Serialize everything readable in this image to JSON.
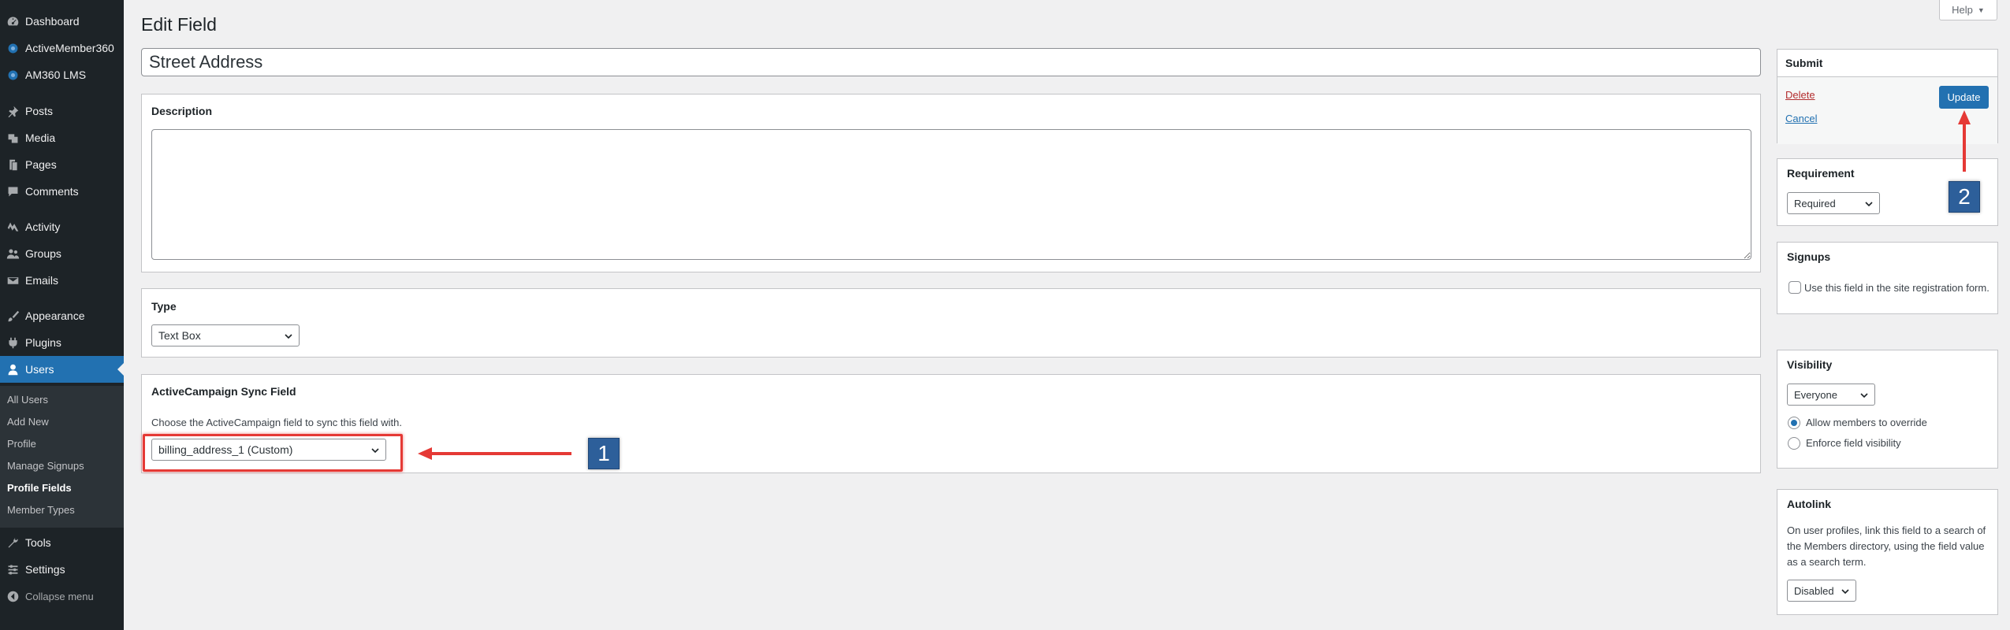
{
  "sidebar": {
    "items": [
      {
        "label": "Dashboard",
        "icon": "dashboard-icon"
      },
      {
        "label": "ActiveMember360",
        "icon": "activemember-icon"
      },
      {
        "label": "AM360 LMS",
        "icon": "lms-icon"
      },
      {
        "label": "Posts",
        "icon": "pin-icon"
      },
      {
        "label": "Media",
        "icon": "media-icon"
      },
      {
        "label": "Pages",
        "icon": "pages-icon"
      },
      {
        "label": "Comments",
        "icon": "comment-icon"
      },
      {
        "label": "Activity",
        "icon": "activity-icon"
      },
      {
        "label": "Groups",
        "icon": "groups-icon"
      },
      {
        "label": "Emails",
        "icon": "email-icon"
      },
      {
        "label": "Appearance",
        "icon": "brush-icon"
      },
      {
        "label": "Plugins",
        "icon": "plugin-icon"
      },
      {
        "label": "Users",
        "icon": "user-icon"
      },
      {
        "label": "Tools",
        "icon": "wrench-icon"
      },
      {
        "label": "Settings",
        "icon": "settings-icon"
      }
    ],
    "submenu": [
      "All Users",
      "Add New",
      "Profile",
      "Manage Signups",
      "Profile Fields",
      "Member Types"
    ],
    "current_item": "Users",
    "current_submenu": "Profile Fields",
    "collapse_label": "Collapse menu"
  },
  "help_tab": {
    "label": "Help"
  },
  "page": {
    "title": "Edit Field",
    "field_name": "Street Address"
  },
  "description": {
    "title": "Description",
    "value": ""
  },
  "type": {
    "title": "Type",
    "selected": "Text Box"
  },
  "activecampaign": {
    "title": "ActiveCampaign Sync Field",
    "help": "Choose the ActiveCampaign field to sync this field with.",
    "selected": "billing_address_1 (Custom)"
  },
  "submit": {
    "title": "Submit",
    "delete_label": "Delete",
    "cancel_label": "Cancel",
    "update_label": "Update"
  },
  "requirement": {
    "title": "Requirement",
    "selected": "Required"
  },
  "signups": {
    "title": "Signups",
    "checkbox_label": "Use this field in the site registration form.",
    "checked": false
  },
  "visibility": {
    "title": "Visibility",
    "selected": "Everyone",
    "option_override": "Allow members to override",
    "option_enforce": "Enforce field visibility",
    "override_checked": true
  },
  "autolink": {
    "title": "Autolink",
    "description": "On user profiles, link this field to a search of the Members directory, using the field value as a search term.",
    "selected": "Disabled"
  },
  "annotations": {
    "callout_1": "1",
    "callout_2": "2",
    "color": "#e53935",
    "callout_color": "#2d5f9a"
  },
  "colors": {
    "sidebar_bg": "#1d2327",
    "submenu_bg": "#2c3338",
    "accent": "#2271b1",
    "delete": "#b32d2e",
    "page_bg": "#f0f0f1"
  }
}
